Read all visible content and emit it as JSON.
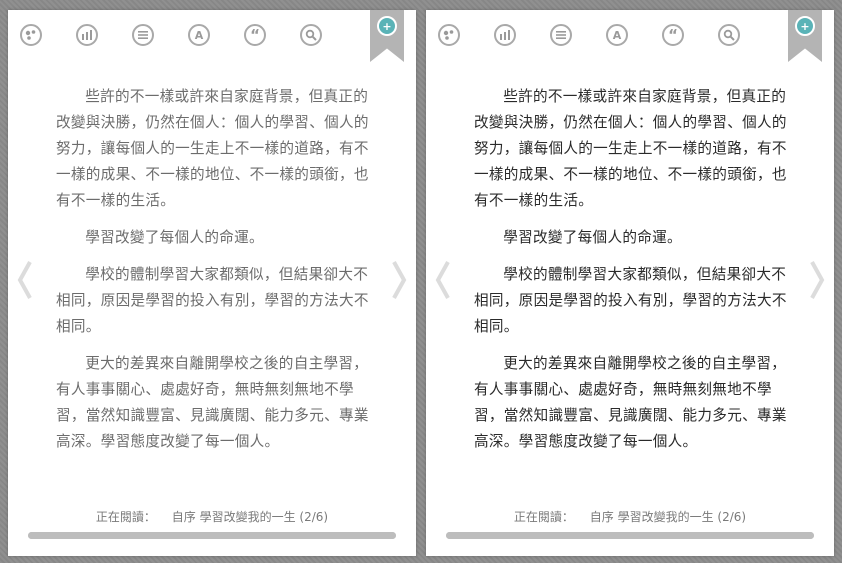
{
  "toolbar": {
    "icons": [
      "palette-icon",
      "chart-icon",
      "list-icon",
      "font-icon",
      "quote-icon",
      "search-icon"
    ],
    "font_glyph": "A",
    "quote_glyph": "“"
  },
  "bookmark": {
    "icon": "bookmark-add-icon"
  },
  "navigation": {
    "prev_icon": "chevron-left-icon",
    "next_icon": "chevron-right-icon"
  },
  "content": {
    "paragraphs": [
      "些許的不一樣或許來自家庭背景，但真正的改變與決勝，仍然在個人：個人的學習、個人的努力，讓每個人的一生走上不一樣的道路，有不一樣的成果、不一樣的地位、不一樣的頭銜，也有不一樣的生活。",
      "學習改變了每個人的命運。",
      "學校的體制學習大家都類似，但結果卻大不相同，原因是學習的投入有別，學習的方法大不相同。",
      "更大的差異來自離開學校之後的自主學習，有人事事關心、處處好奇，無時無刻無地不學習，當然知識豐富、見識廣闊、能力多元、專業高深。學習態度改變了每一個人。"
    ]
  },
  "footer": {
    "reading_label": "正在閱讀：",
    "chapter": "自序 學習改變我的一生 (2/6)"
  },
  "progress": {
    "fraction": 1.0
  },
  "colors": {
    "accent": "#5ab3b7",
    "icon": "#a9a9a9",
    "background": "#8c8c8c"
  }
}
